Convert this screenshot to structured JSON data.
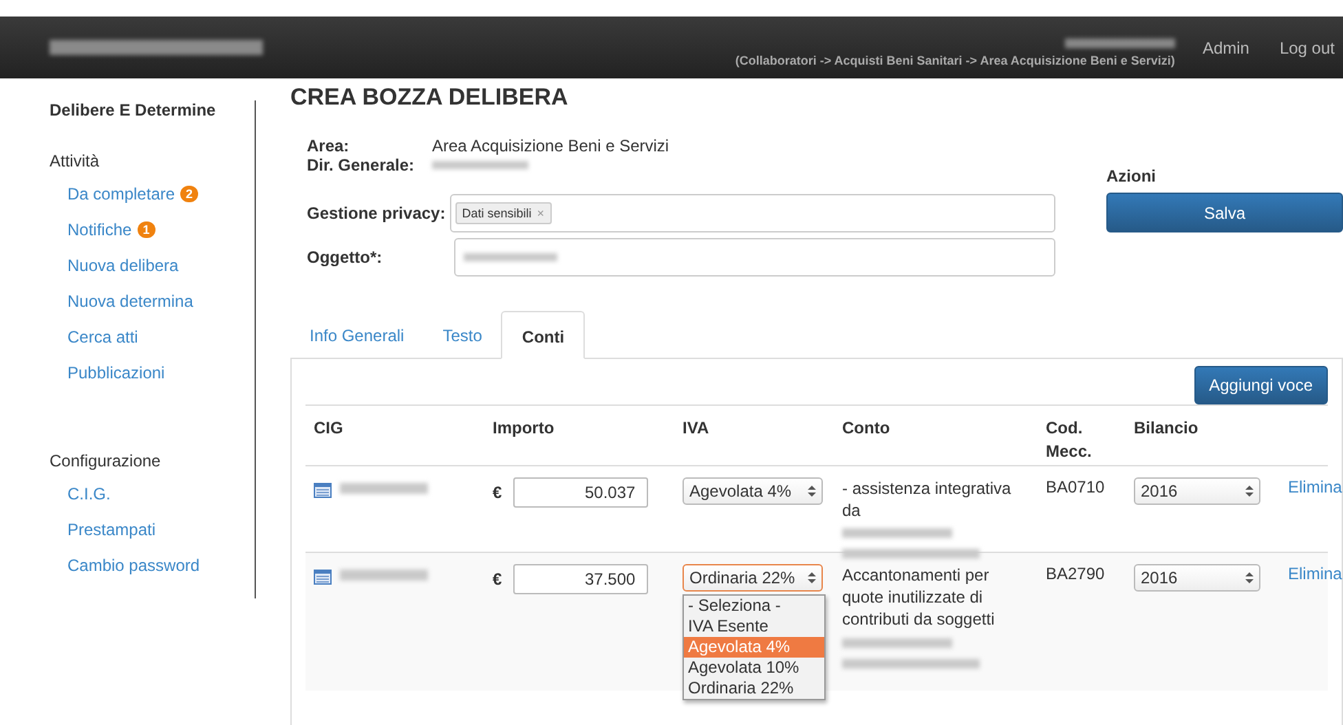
{
  "topbar": {
    "breadcrumb": "(Collaboratori -> Acquisti Beni Sanitari -> Area Acquisizione Beni e Servizi)",
    "links": [
      "Admin",
      "Log out"
    ]
  },
  "sidebar": {
    "title": "Delibere E Determine",
    "sections": [
      {
        "title": "Attività",
        "items": [
          {
            "label": "Da completare",
            "badge": "2"
          },
          {
            "label": "Notifiche",
            "badge": "1"
          },
          {
            "label": "Nuova delibera"
          },
          {
            "label": "Nuova determina"
          },
          {
            "label": "Cerca atti"
          },
          {
            "label": "Pubblicazioni"
          }
        ]
      },
      {
        "title": "Configurazione",
        "items": [
          {
            "label": "C.I.G."
          },
          {
            "label": "Prestampati"
          },
          {
            "label": "Cambio password"
          }
        ]
      }
    ]
  },
  "page": {
    "title": "CREA BOZZA DELIBERA",
    "area_label": "Area:",
    "area_value": "Area Acquisizione Beni e Servizi",
    "dir_label": "Dir. Generale:",
    "privacy_label": "Gestione privacy:",
    "privacy_tags": [
      {
        "label": "Dati sensibili",
        "remove": "×"
      }
    ],
    "oggetto_label": "Oggetto*:"
  },
  "actions": {
    "title": "Azioni",
    "button": "Salva"
  },
  "tabs": [
    {
      "label": "Info Generali",
      "selected": false
    },
    {
      "label": "Testo",
      "selected": false
    },
    {
      "label": "Conti",
      "selected": true
    }
  ],
  "table": {
    "add_button": "Aggiungi voce",
    "columns": [
      "CIG",
      "Importo",
      "IVA",
      "Conto",
      "Cod. Mecc.",
      "Bilancio"
    ],
    "rows": [
      {
        "currency": "€",
        "amount": "50.037",
        "iva": "Agevolata 4%",
        "conto": "- assistenza integrativa da",
        "code": "BA0710",
        "bilancio": "2016",
        "action": "Elimina",
        "highlighted": false,
        "focused": false
      },
      {
        "currency": "€",
        "amount": "37.500",
        "iva": "Ordinaria 22%",
        "conto": "Accantonamenti per quote inutilizzate di contributi da soggetti",
        "code": "BA2790",
        "bilancio": "2016",
        "action": "Elimina",
        "highlighted": true,
        "focused": true
      }
    ]
  },
  "dropdown": {
    "options": [
      {
        "label": "- Seleziona -",
        "selected": false
      },
      {
        "label": "IVA Esente",
        "selected": false
      },
      {
        "label": "Agevolata 4%",
        "selected": true
      },
      {
        "label": "Agevolata 10%",
        "selected": false
      },
      {
        "label": "Ordinaria 22%",
        "selected": false
      }
    ]
  }
}
